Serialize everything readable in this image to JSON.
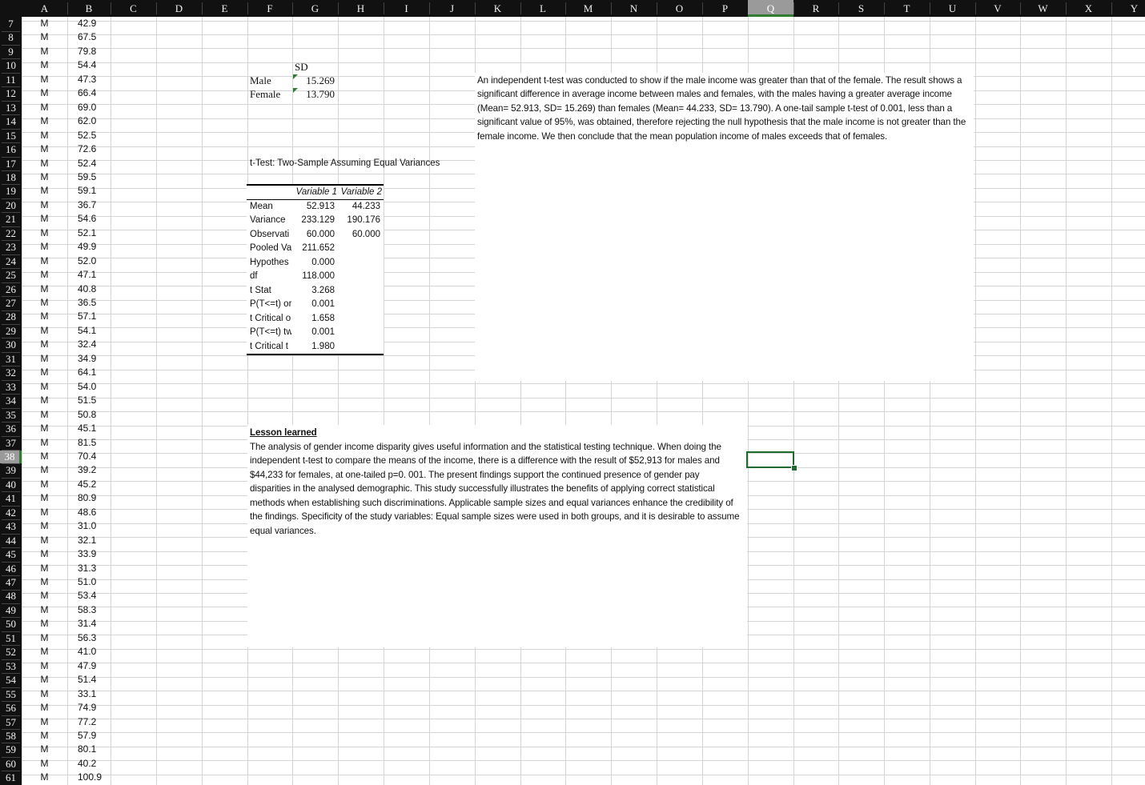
{
  "columns": [
    "A",
    "B",
    "C",
    "D",
    "E",
    "F",
    "G",
    "H",
    "I",
    "J",
    "K",
    "L",
    "M",
    "N",
    "O",
    "P",
    "Q",
    "R",
    "S",
    "T",
    "U",
    "V",
    "W",
    "X",
    "Y"
  ],
  "selected_column": "Q",
  "selected_row": "38",
  "rows": [
    "7",
    "8",
    "9",
    "10",
    "11",
    "12",
    "13",
    "14",
    "15",
    "16",
    "17",
    "18",
    "19",
    "20",
    "21",
    "22",
    "23",
    "24",
    "25",
    "26",
    "27",
    "28",
    "29",
    "30",
    "31",
    "32",
    "33",
    "34",
    "35",
    "36",
    "37",
    "38",
    "39",
    "40",
    "41",
    "42",
    "43",
    "44",
    "45",
    "46",
    "47",
    "48",
    "49",
    "50",
    "51",
    "52",
    "53",
    "54",
    "55",
    "56",
    "57",
    "58",
    "59",
    "60",
    "61"
  ],
  "column_a": [
    "M",
    "M",
    "M",
    "M",
    "M",
    "M",
    "M",
    "M",
    "M",
    "M",
    "M",
    "M",
    "M",
    "M",
    "M",
    "M",
    "M",
    "M",
    "M",
    "M",
    "M",
    "M",
    "M",
    "M",
    "M",
    "M",
    "M",
    "M",
    "M",
    "M",
    "M",
    "M",
    "M",
    "M",
    "M",
    "M",
    "M",
    "M",
    "M",
    "M",
    "M",
    "M",
    "M",
    "M",
    "M",
    "M",
    "M",
    "M",
    "M",
    "M",
    "M",
    "M",
    "M",
    "M",
    "M"
  ],
  "column_b": [
    "42.9",
    "67.5",
    "79.8",
    "54.4",
    "47.3",
    "66.4",
    "69.0",
    "62.0",
    "52.5",
    "72.6",
    "52.4",
    "59.5",
    "59.1",
    "36.7",
    "54.6",
    "52.1",
    "49.9",
    "52.0",
    "47.1",
    "40.8",
    "36.5",
    "57.1",
    "54.1",
    "32.4",
    "34.9",
    "64.1",
    "54.0",
    "51.5",
    "50.8",
    "45.1",
    "81.5",
    "70.4",
    "39.2",
    "45.2",
    "80.9",
    "48.6",
    "31.0",
    "32.1",
    "33.9",
    "31.3",
    "51.0",
    "53.4",
    "58.3",
    "31.4",
    "56.3",
    "41.0",
    "47.9",
    "51.4",
    "33.1",
    "74.9",
    "77.2",
    "57.9",
    "80.1",
    "40.2",
    "100.9"
  ],
  "sd_table": {
    "header": "SD",
    "rows": [
      {
        "label": "Male",
        "value": "15.269"
      },
      {
        "label": "Female",
        "value": "13.790"
      }
    ]
  },
  "ttest": {
    "title": "t-Test: Two-Sample Assuming Equal Variances",
    "col1_header": "Variable 1",
    "col2_header": "Variable 2",
    "rows": [
      {
        "label": "Mean",
        "v1": "52.913",
        "v2": "44.233"
      },
      {
        "label": "Variance",
        "v1": "233.129",
        "v2": "190.176"
      },
      {
        "label": "Observati",
        "v1": "60.000",
        "v2": "60.000"
      },
      {
        "label": "Pooled Va",
        "v1": "211.652",
        "v2": ""
      },
      {
        "label": "Hypothes",
        "v1": "0.000",
        "v2": ""
      },
      {
        "label": "df",
        "v1": "118.000",
        "v2": ""
      },
      {
        "label": "t Stat",
        "v1": "3.268",
        "v2": ""
      },
      {
        "label": "P(T<=t) or",
        "v1": "0.001",
        "v2": ""
      },
      {
        "label": "t Critical o",
        "v1": "1.658",
        "v2": ""
      },
      {
        "label": "P(T<=t) tw",
        "v1": "0.001",
        "v2": ""
      },
      {
        "label": "t Critical t",
        "v1": "1.980",
        "v2": ""
      }
    ]
  },
  "conclusion_text": "An independent t-test was conducted to show if the male income was greater than that of the female. The result shows a significant difference in average income between males and females, with the males having a greater average income (Mean= 52.913, SD= 15.269) than females (Mean= 44.233, SD= 13.790). A one-tail sample t-test of 0.001, less than a significant value of 95%, was obtained, therefore rejecting the null hypothesis that the male income is not greater than the female income. We then conclude that the mean population income of males exceeds that of females.",
  "lesson": {
    "title": "Lesson learned",
    "body": "The analysis of gender income disparity gives useful information and the statistical testing technique. When doing the independent t-test to compare the means of the income, there is a difference with the result of $52,913 for males and $44,233 for females, at one-tailed p=0. 001. The present findings support the continued presence of gender pay disparities in the analysed demographic. This study successfully illustrates the benefits of applying correct statistical methods when establishing such discriminations. Applicable sample sizes and equal variances enhance the credibility of the findings. Specificity of the study variables: Equal sample sizes were used in both groups, and it is desirable to assume equal variances."
  },
  "colors": {
    "header_bg": "#111111",
    "header_selected_bg": "#9a9a9a",
    "selection": "#1e6b2e",
    "gridline": "#d4d4d4"
  }
}
